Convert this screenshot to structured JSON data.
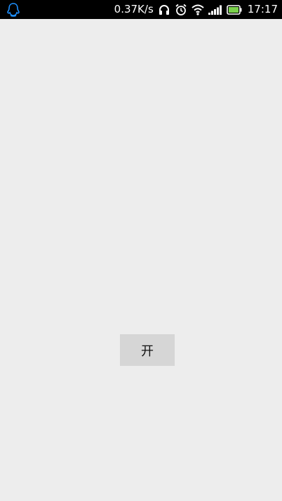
{
  "status_bar": {
    "net_speed": "0.37K/s",
    "time": "17:17",
    "icons": [
      "qq-penguin-icon",
      "headphones-icon",
      "alarm-clock-icon",
      "wifi-icon",
      "signal-icon",
      "battery-icon"
    ],
    "accent_color": "#1e90ff",
    "battery_color": "#7ad14b"
  },
  "main": {
    "button_label": "开"
  }
}
